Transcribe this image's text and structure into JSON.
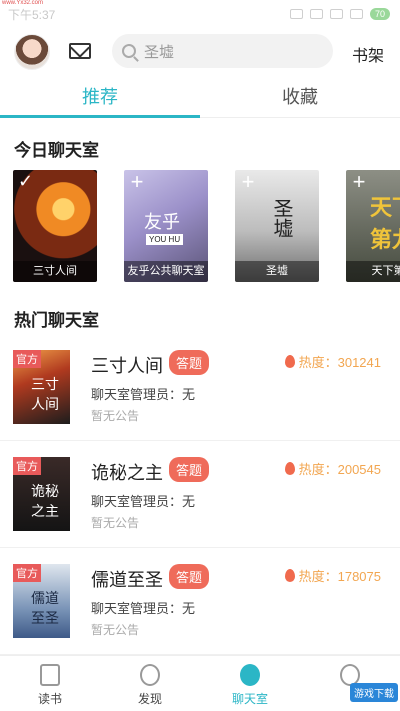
{
  "status_bar": {
    "time": "下午5:37",
    "battery": "70",
    "watermark": "www.Yx32.com"
  },
  "header": {
    "search_placeholder": "圣墟",
    "bookshelf": "书架"
  },
  "tabs": [
    {
      "label": "推荐"
    },
    {
      "label": "收藏"
    }
  ],
  "today": {
    "title": "今日聊天室",
    "cards": [
      {
        "label": "三寸人间",
        "cover_text": "三寸人间",
        "selected": true
      },
      {
        "label": "友乎公共聊天室",
        "cover_text": "友乎",
        "cover_sub": "YOU HU"
      },
      {
        "label": "圣墟",
        "cover_text": "圣墟"
      },
      {
        "label": "天下第",
        "cover_text": "天下第九"
      }
    ]
  },
  "hot": {
    "title": "热门聊天室",
    "official_label": "官方",
    "tag_label": "答题",
    "items": [
      {
        "name": "三寸人间",
        "cover_text": "三寸人间",
        "heat": "热度：301241",
        "admin": "聊天室管理员：无",
        "notice": "暂无公告"
      },
      {
        "name": "诡秘之主",
        "cover_text": "诡秘之主",
        "heat": "热度：200545",
        "admin": "聊天室管理员：无",
        "notice": "暂无公告"
      },
      {
        "name": "儒道至圣",
        "cover_text": "儒道至圣",
        "heat": "热度：178075",
        "admin": "聊天室管理员：无",
        "notice": "暂无公告"
      }
    ]
  },
  "bottom_nav": [
    {
      "label": "读书",
      "icon": "book-icon"
    },
    {
      "label": "发现",
      "icon": "compass-icon"
    },
    {
      "label": "聊天室",
      "icon": "chat-bulb-icon",
      "active": true
    },
    {
      "label": "",
      "icon": "game-icon"
    }
  ],
  "watermark_badge": "游戏下载",
  "colors": {
    "accent": "#2bb6c6",
    "tag": "#ef6b5a",
    "heat": "#f2a651",
    "official": "#e85a5a"
  }
}
